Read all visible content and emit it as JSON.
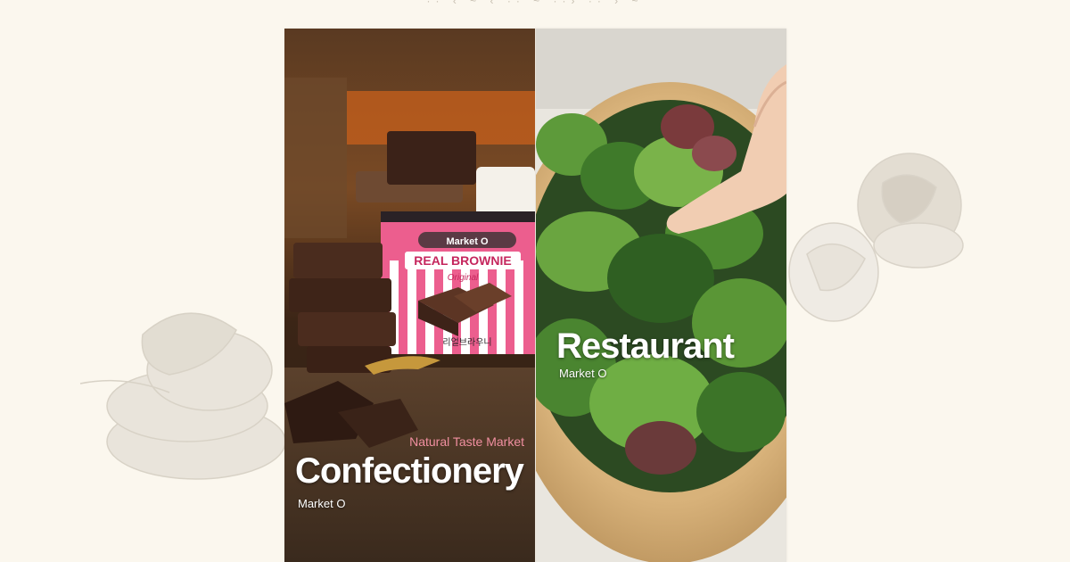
{
  "colors": {
    "page_background": "#fbf7ee",
    "tagline_pink": "#f08fa0",
    "title_white": "#ffffff"
  },
  "panels": {
    "confectionery": {
      "tagline": "Natural Taste Market",
      "title": "Confectionery",
      "subtitle": "Market O",
      "package": {
        "brand": "Market O",
        "product": "REAL BROWNIE",
        "variant": "Original",
        "korean": "리얼브라우니"
      }
    },
    "restaurant": {
      "title": "Restaurant",
      "subtitle": "Market O"
    }
  }
}
